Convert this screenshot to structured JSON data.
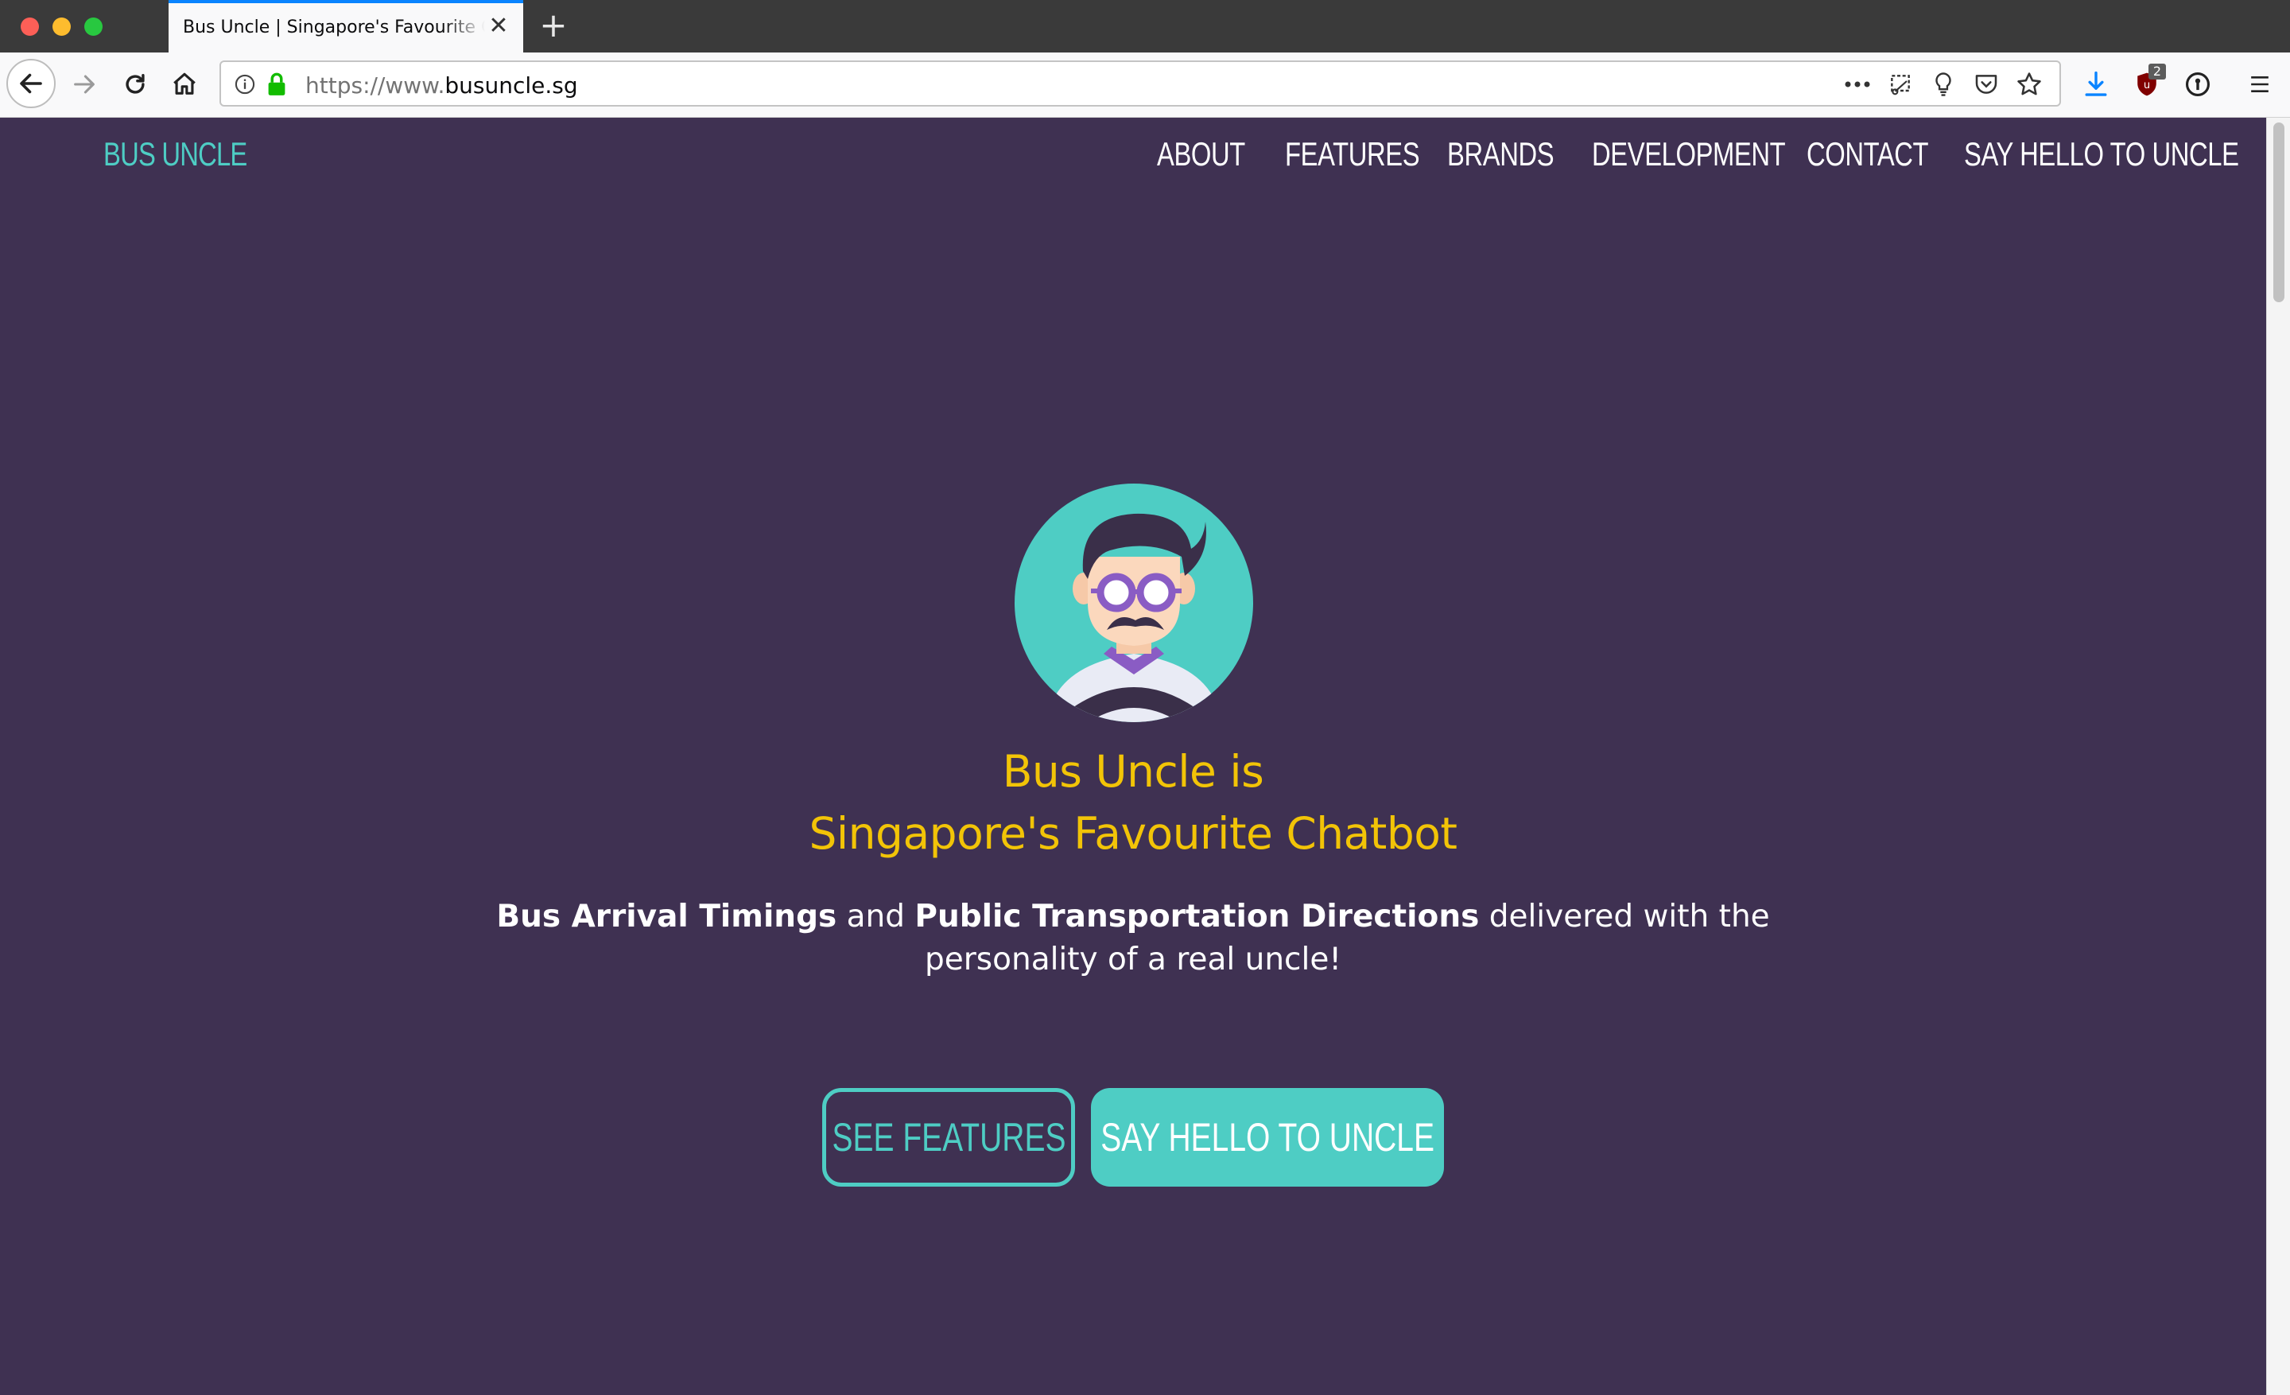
{
  "browser": {
    "tab_title": "Bus Uncle | Singapore's Favourite Chatbot",
    "url_scheme": "https://www.",
    "url_host": "busuncle.sg",
    "extension_badge": "2",
    "icons": {
      "back": "back-arrow-icon",
      "forward": "forward-arrow-icon",
      "reload": "reload-icon",
      "home": "home-icon",
      "info": "info-icon",
      "lock": "lock-icon",
      "more": "more-dots-icon",
      "screenshot": "screenshot-icon",
      "lightbulb": "lightbulb-icon",
      "pocket": "pocket-icon",
      "bookmark": "star-icon",
      "download": "download-icon",
      "ublock": "ublock-shield-icon",
      "password": "password-manager-icon",
      "menu": "hamburger-menu-icon"
    }
  },
  "site": {
    "brand": "BUS UNCLE",
    "nav": [
      "ABOUT",
      "FEATURES",
      "BRANDS",
      "DEVELOPMENT",
      "CONTACT",
      "SAY HELLO TO UNCLE"
    ],
    "hero": {
      "title_line1": "Bus Uncle is",
      "title_line2": "Singapore's Favourite Chatbot",
      "desc_bold1": "Bus Arrival Timings",
      "desc_mid": " and ",
      "desc_bold2": "Public Transportation Directions",
      "desc_rest": " delivered with the personality of a real uncle!",
      "btn_features": "SEE FEATURES",
      "btn_hello": "SAY HELLO TO UNCLE"
    }
  },
  "colors": {
    "background": "#3f3152",
    "accent": "#4ecdc4",
    "headline": "#f2c407",
    "text": "#ffffff"
  }
}
